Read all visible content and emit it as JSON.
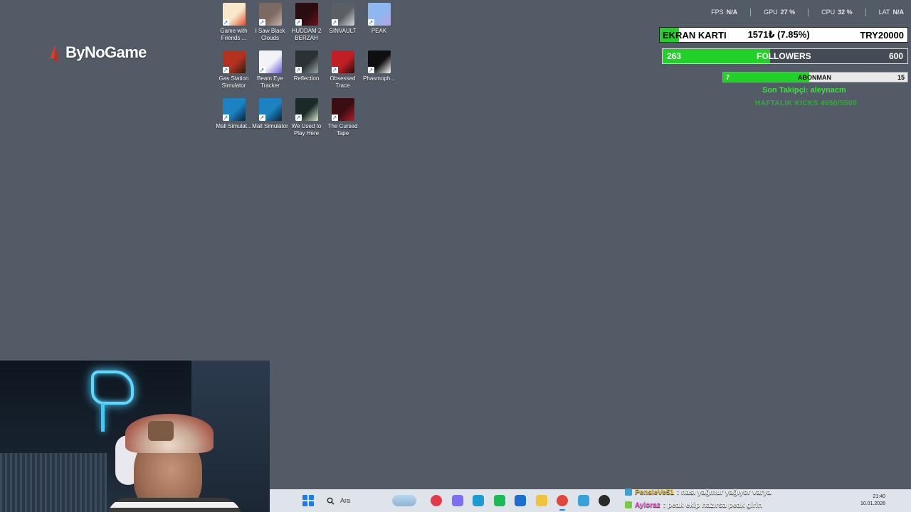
{
  "logo": {
    "text": "ByNoGame"
  },
  "desktop": {
    "icons": [
      {
        "label": "Game with Friends ...",
        "color": "#f6e8c9",
        "accent": "#e34b2a",
        "icon": "game-with-friends-icon"
      },
      {
        "label": "I Saw Black Clouds",
        "color": "#7a6a62",
        "accent": "#c9b1a4",
        "icon": "i-saw-black-clouds-icon"
      },
      {
        "label": "HUDDAM 2 BERZAH",
        "color": "#2a0d10",
        "accent": "#6e1218",
        "icon": "huddam-icon"
      },
      {
        "label": "SINVAULT",
        "color": "#5a5f66",
        "accent": "#d8d8d8",
        "icon": "sinvault-icon"
      },
      {
        "label": "PEAK",
        "color": "#8fb7ef",
        "accent": "#b7a1e2",
        "icon": "peak-icon"
      },
      {
        "label": "Gas Station Simulator",
        "color": "#b3331f",
        "accent": "#2a1a14",
        "icon": "gas-station-icon"
      },
      {
        "label": "Beam Eye Tracker",
        "color": "#f2f2f7",
        "accent": "#6a5bd8",
        "icon": "beam-eye-icon"
      },
      {
        "label": "Reflection",
        "color": "#2a3236",
        "accent": "#9aa8a6",
        "icon": "reflection-icon"
      },
      {
        "label": "Obsessed Trace",
        "color": "#c21f25",
        "accent": "#2a0a0c",
        "icon": "obsessed-trace-icon"
      },
      {
        "label": "Phasmoph...",
        "color": "#0f0f10",
        "accent": "#ffffff",
        "icon": "phasmophobia-icon"
      },
      {
        "label": "Mall Simulat...",
        "color": "#1c82c2",
        "accent": "#0a2238",
        "icon": "mall-sim-icon"
      },
      {
        "label": "Mall Simulator",
        "color": "#1c82c2",
        "accent": "#0a2238",
        "icon": "mall-sim-icon"
      },
      {
        "label": "We Used to Play Here",
        "color": "#1b2a26",
        "accent": "#d8e6d0",
        "icon": "we-used-to-play-icon"
      },
      {
        "label": "The Cursed Tape",
        "color": "#3a0d10",
        "accent": "#b31d2a",
        "icon": "cursed-tape-icon"
      }
    ]
  },
  "stats": {
    "fps_label": "FPS",
    "fps_value": "N/A",
    "gpu_label": "GPU",
    "gpu_value": "27 %",
    "cpu_label": "CPU",
    "cpu_value": "32 %",
    "lat_label": "LAT",
    "lat_value": "N/A"
  },
  "goal": {
    "label": "EKRAN KARTI",
    "current": "1571₺ (7.85%)",
    "target": "TRY20000",
    "progress": 0.0785
  },
  "followers": {
    "current": "263",
    "label": "FOLLOWERS",
    "target": "600",
    "progress": 0.4383
  },
  "subscribers": {
    "current": "7",
    "label": "ABONMAN",
    "target": "15",
    "progress": 0.4667
  },
  "last_follower": "Son Takipçi: aleynacm",
  "weekly_kicks": "HAFTALIK KICKS 4650/5500",
  "taskbar": {
    "search_placeholder": "Ara",
    "apps": [
      {
        "icon": "media-player-icon",
        "color": "#e53a4a"
      },
      {
        "icon": "copilot-icon",
        "color": "#7c6ff2"
      },
      {
        "icon": "edge-icon",
        "color": "#1a9bd6"
      },
      {
        "icon": "spotify-icon",
        "color": "#1db954"
      },
      {
        "icon": "store-icon",
        "color": "#1d6fcf"
      },
      {
        "icon": "file-explorer-icon",
        "color": "#f2c23a"
      },
      {
        "icon": "chrome-icon",
        "color": "#e0483b"
      },
      {
        "icon": "settings-app-icon",
        "color": "#3aa0d8"
      },
      {
        "icon": "obs-icon",
        "color": "#2a2a2a"
      }
    ],
    "clock_time": "21:40",
    "clock_date": "10.01.2026"
  },
  "chat": [
    {
      "user": "PensleVe51",
      "message": ": nası yağmur yağıyor varya"
    },
    {
      "user": "Ayloraz",
      "message": ": peak ekip hazırsa peak girin"
    }
  ]
}
